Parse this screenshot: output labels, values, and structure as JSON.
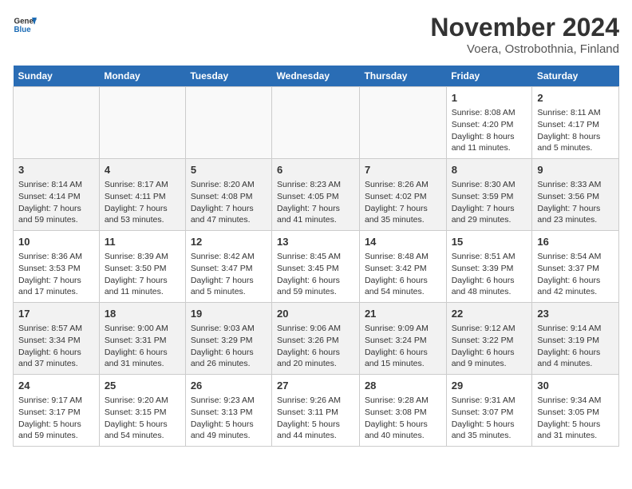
{
  "header": {
    "logo_line1": "General",
    "logo_line2": "Blue",
    "month_year": "November 2024",
    "location": "Voera, Ostrobothnia, Finland"
  },
  "days_of_week": [
    "Sunday",
    "Monday",
    "Tuesday",
    "Wednesday",
    "Thursday",
    "Friday",
    "Saturday"
  ],
  "weeks": [
    [
      {
        "day": "",
        "content": ""
      },
      {
        "day": "",
        "content": ""
      },
      {
        "day": "",
        "content": ""
      },
      {
        "day": "",
        "content": ""
      },
      {
        "day": "",
        "content": ""
      },
      {
        "day": "1",
        "content": "Sunrise: 8:08 AM\nSunset: 4:20 PM\nDaylight: 8 hours and 11 minutes."
      },
      {
        "day": "2",
        "content": "Sunrise: 8:11 AM\nSunset: 4:17 PM\nDaylight: 8 hours and 5 minutes."
      }
    ],
    [
      {
        "day": "3",
        "content": "Sunrise: 8:14 AM\nSunset: 4:14 PM\nDaylight: 7 hours and 59 minutes."
      },
      {
        "day": "4",
        "content": "Sunrise: 8:17 AM\nSunset: 4:11 PM\nDaylight: 7 hours and 53 minutes."
      },
      {
        "day": "5",
        "content": "Sunrise: 8:20 AM\nSunset: 4:08 PM\nDaylight: 7 hours and 47 minutes."
      },
      {
        "day": "6",
        "content": "Sunrise: 8:23 AM\nSunset: 4:05 PM\nDaylight: 7 hours and 41 minutes."
      },
      {
        "day": "7",
        "content": "Sunrise: 8:26 AM\nSunset: 4:02 PM\nDaylight: 7 hours and 35 minutes."
      },
      {
        "day": "8",
        "content": "Sunrise: 8:30 AM\nSunset: 3:59 PM\nDaylight: 7 hours and 29 minutes."
      },
      {
        "day": "9",
        "content": "Sunrise: 8:33 AM\nSunset: 3:56 PM\nDaylight: 7 hours and 23 minutes."
      }
    ],
    [
      {
        "day": "10",
        "content": "Sunrise: 8:36 AM\nSunset: 3:53 PM\nDaylight: 7 hours and 17 minutes."
      },
      {
        "day": "11",
        "content": "Sunrise: 8:39 AM\nSunset: 3:50 PM\nDaylight: 7 hours and 11 minutes."
      },
      {
        "day": "12",
        "content": "Sunrise: 8:42 AM\nSunset: 3:47 PM\nDaylight: 7 hours and 5 minutes."
      },
      {
        "day": "13",
        "content": "Sunrise: 8:45 AM\nSunset: 3:45 PM\nDaylight: 6 hours and 59 minutes."
      },
      {
        "day": "14",
        "content": "Sunrise: 8:48 AM\nSunset: 3:42 PM\nDaylight: 6 hours and 54 minutes."
      },
      {
        "day": "15",
        "content": "Sunrise: 8:51 AM\nSunset: 3:39 PM\nDaylight: 6 hours and 48 minutes."
      },
      {
        "day": "16",
        "content": "Sunrise: 8:54 AM\nSunset: 3:37 PM\nDaylight: 6 hours and 42 minutes."
      }
    ],
    [
      {
        "day": "17",
        "content": "Sunrise: 8:57 AM\nSunset: 3:34 PM\nDaylight: 6 hours and 37 minutes."
      },
      {
        "day": "18",
        "content": "Sunrise: 9:00 AM\nSunset: 3:31 PM\nDaylight: 6 hours and 31 minutes."
      },
      {
        "day": "19",
        "content": "Sunrise: 9:03 AM\nSunset: 3:29 PM\nDaylight: 6 hours and 26 minutes."
      },
      {
        "day": "20",
        "content": "Sunrise: 9:06 AM\nSunset: 3:26 PM\nDaylight: 6 hours and 20 minutes."
      },
      {
        "day": "21",
        "content": "Sunrise: 9:09 AM\nSunset: 3:24 PM\nDaylight: 6 hours and 15 minutes."
      },
      {
        "day": "22",
        "content": "Sunrise: 9:12 AM\nSunset: 3:22 PM\nDaylight: 6 hours and 9 minutes."
      },
      {
        "day": "23",
        "content": "Sunrise: 9:14 AM\nSunset: 3:19 PM\nDaylight: 6 hours and 4 minutes."
      }
    ],
    [
      {
        "day": "24",
        "content": "Sunrise: 9:17 AM\nSunset: 3:17 PM\nDaylight: 5 hours and 59 minutes."
      },
      {
        "day": "25",
        "content": "Sunrise: 9:20 AM\nSunset: 3:15 PM\nDaylight: 5 hours and 54 minutes."
      },
      {
        "day": "26",
        "content": "Sunrise: 9:23 AM\nSunset: 3:13 PM\nDaylight: 5 hours and 49 minutes."
      },
      {
        "day": "27",
        "content": "Sunrise: 9:26 AM\nSunset: 3:11 PM\nDaylight: 5 hours and 44 minutes."
      },
      {
        "day": "28",
        "content": "Sunrise: 9:28 AM\nSunset: 3:08 PM\nDaylight: 5 hours and 40 minutes."
      },
      {
        "day": "29",
        "content": "Sunrise: 9:31 AM\nSunset: 3:07 PM\nDaylight: 5 hours and 35 minutes."
      },
      {
        "day": "30",
        "content": "Sunrise: 9:34 AM\nSunset: 3:05 PM\nDaylight: 5 hours and 31 minutes."
      }
    ]
  ]
}
